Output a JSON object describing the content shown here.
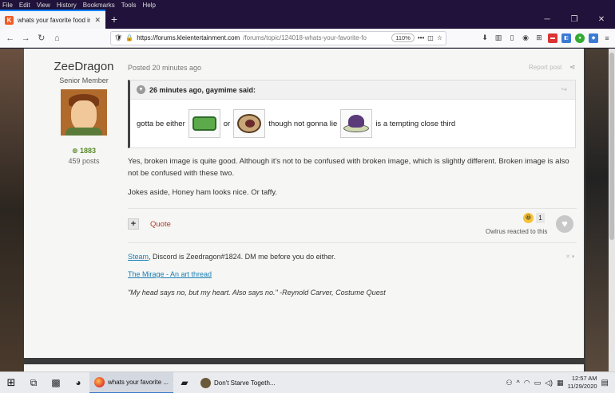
{
  "browser": {
    "menu": [
      "File",
      "Edit",
      "View",
      "History",
      "Bookmarks",
      "Tools",
      "Help"
    ],
    "tab_title": "whats your favorite food in ter",
    "url_domain": "https://forums.kleientertainment.com",
    "url_path": "/forums/topic/124018-whats-your-favorite-fo",
    "zoom": "110%"
  },
  "post": {
    "author_name": "ZeeDragon",
    "author_rank": "Senior Member",
    "reputation": "1883",
    "post_count": "459 posts",
    "posted_time": "Posted 20 minutes ago",
    "report": "Report post",
    "quote": {
      "header": "26 minutes ago, gaymime said:",
      "text_1": "gotta be either",
      "text_2": "or",
      "text_3": "though not gonna lie",
      "text_4": "is a tempting close third"
    },
    "paragraph_1": "Yes, broken image is quite good. Although it's not to be confused with broken image, which is slightly different. Broken image is also not be confused with these two.",
    "paragraph_2": "Jokes aside, Honey ham looks nice. Or taffy.",
    "quote_button": "Quote",
    "reaction_count": "1",
    "reacted_text": "Owlrus reacted to this",
    "signature": {
      "steam_link": "Steam",
      "steam_rest": ", Discord is Zeedragon#1824. DM me before you do either.",
      "thread_link": "The Mirage - An art thread",
      "quote_line": "\"My head says no, but my heart. Also says no.\" -Reynold Carver, Costume Quest"
    }
  },
  "taskbar": {
    "firefox_label": "whats your favorite ...",
    "dst_label": "Don't Starve Togeth...",
    "time": "12:57 AM",
    "date": "11/29/2020"
  },
  "colors": {
    "accent_red": "#b23a2c",
    "link_blue": "#1a7fb5",
    "rep_green": "#5a8a2a"
  }
}
